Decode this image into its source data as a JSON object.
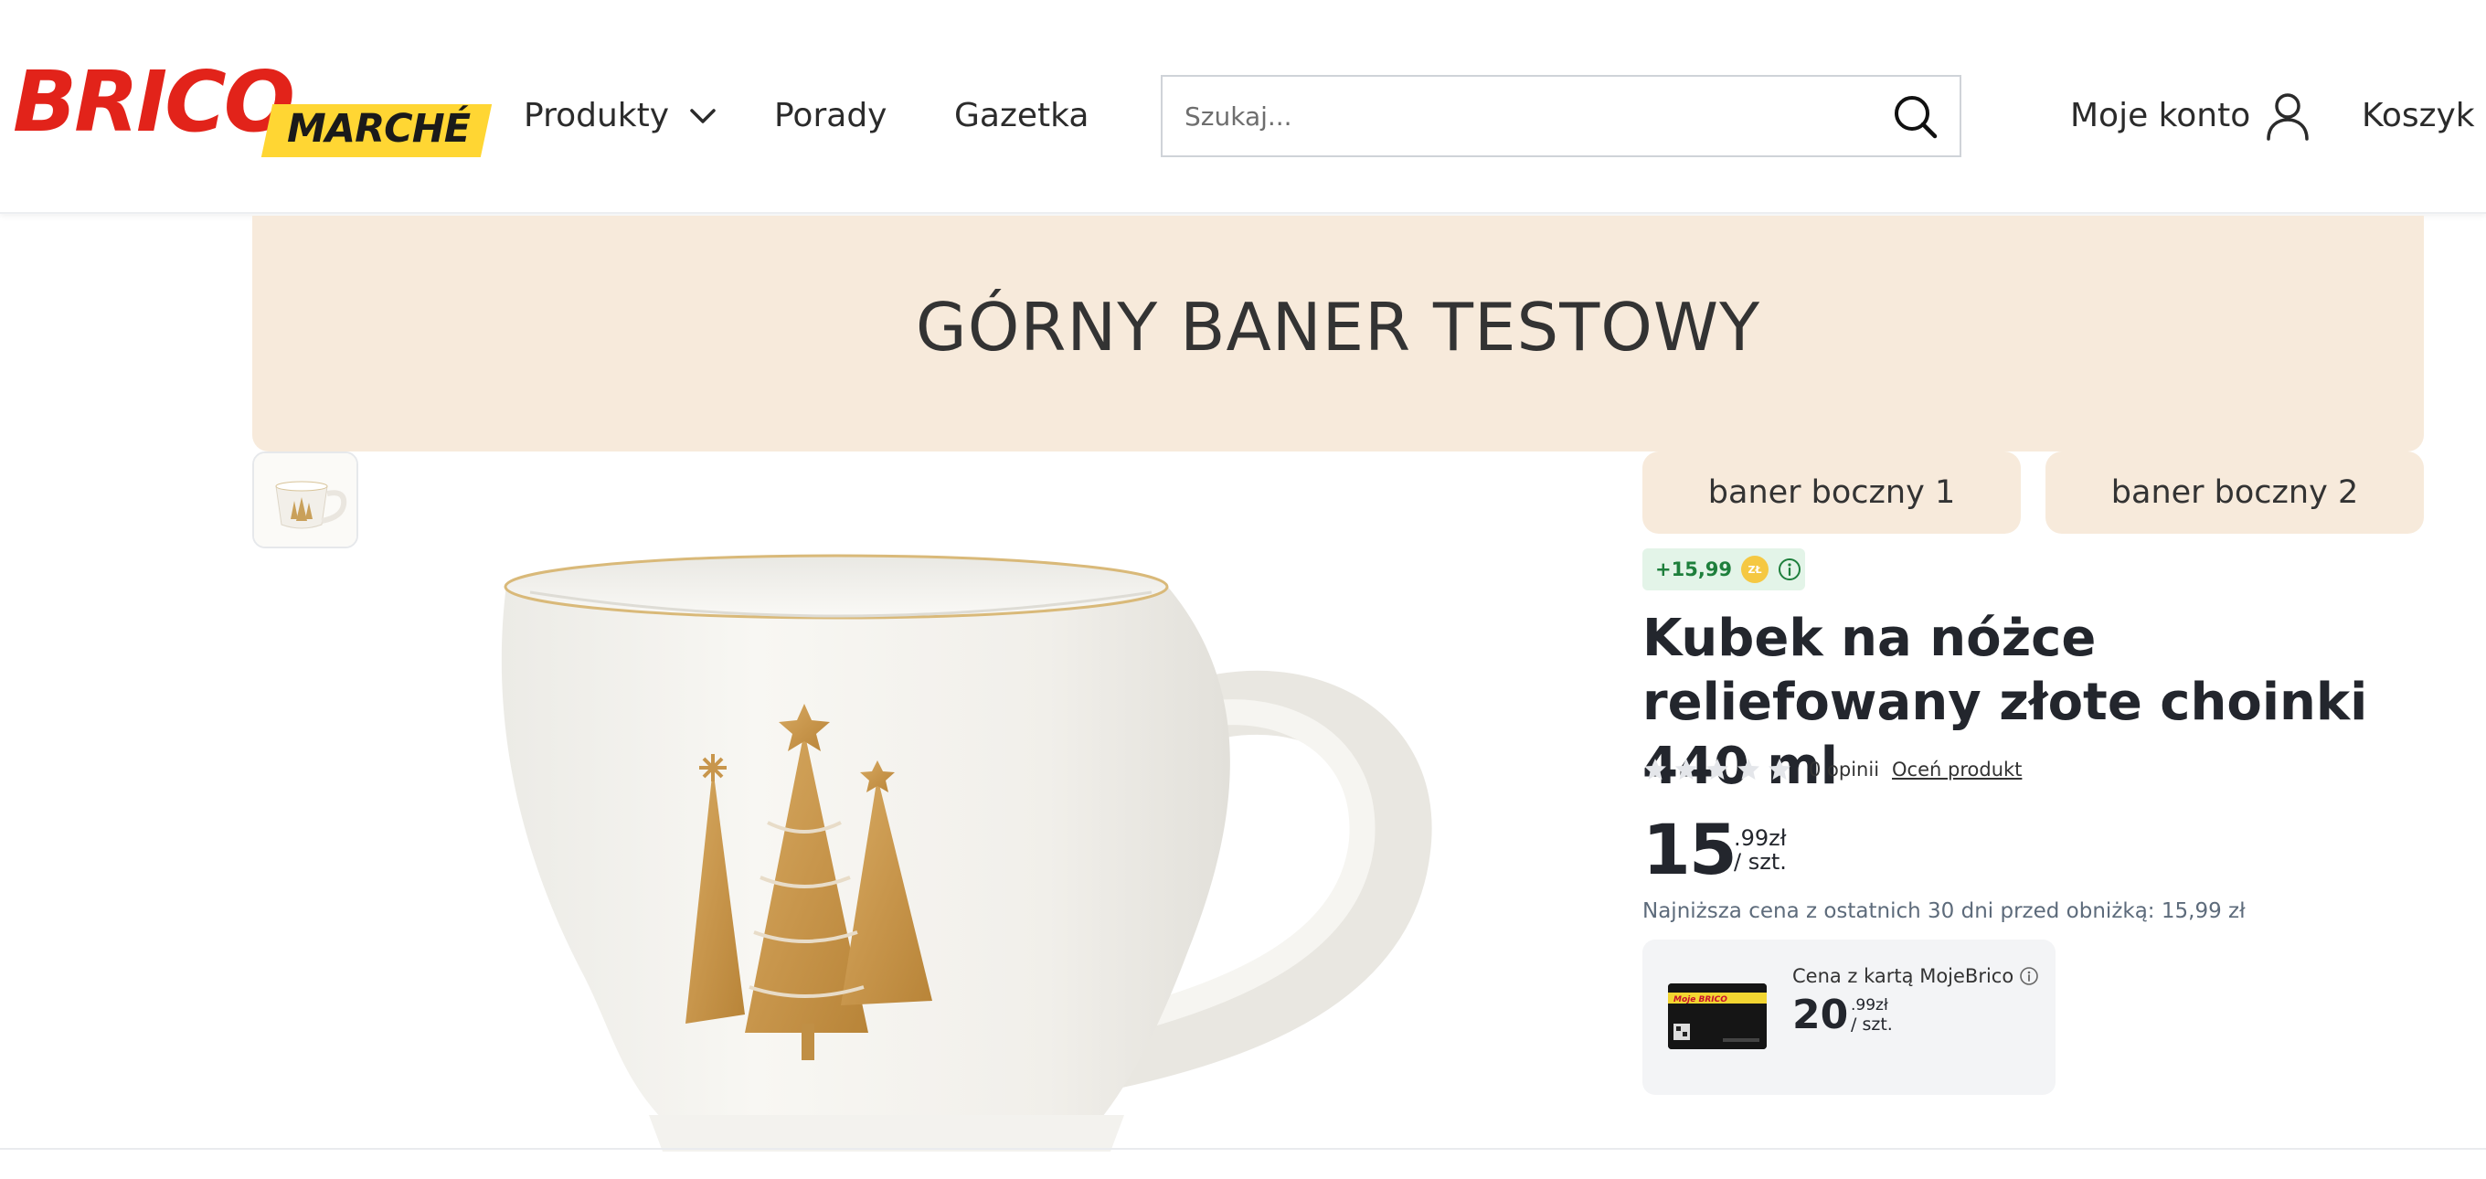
{
  "header": {
    "logo": {
      "brico": "BRICO",
      "marche": "MARCHÉ"
    },
    "nav": {
      "produkty": "Produkty",
      "porady": "Porady",
      "gazetka": "Gazetka"
    },
    "search": {
      "placeholder": "Szukaj..."
    },
    "account_label": "Moje konto",
    "cart_label": "Koszyk |"
  },
  "top_banner": {
    "text": "GÓRNY BANER TESTOWY"
  },
  "side_banners": {
    "first": "baner boczny 1",
    "second": "baner boczny 2"
  },
  "product": {
    "points": "+15,99",
    "coin_label": "ZŁ",
    "title": "Kubek na nóżce reliefowany złote choinki 440 ml",
    "rating": {
      "stars": 0,
      "max": 5,
      "count_text": "0 opinii",
      "rate_link": "Oceń produkt"
    },
    "price": {
      "integer": "15",
      "decimal": ".99zł",
      "unit": "/ szt."
    },
    "lowest_price_text": "Najniższa cena z ostatnich 30 dni przed obniżką: 15,99 zł",
    "card": {
      "label": "Cena z kartą MojeBrico",
      "price_integer": "20",
      "price_decimal": ".99zł",
      "price_unit": "/ szt."
    }
  },
  "colors": {
    "brand_red": "#e2231a",
    "brand_yellow": "#ffd633",
    "banner_beige": "#f7eadb",
    "points_green": "#1e7f3c",
    "text_dark": "#23262d"
  },
  "icons": {
    "nav_dropdown": "chevron-down-icon",
    "search": "search-icon",
    "account": "user-icon",
    "points_info": "info-icon",
    "card_info": "info-icon",
    "rating": "star-icon"
  }
}
